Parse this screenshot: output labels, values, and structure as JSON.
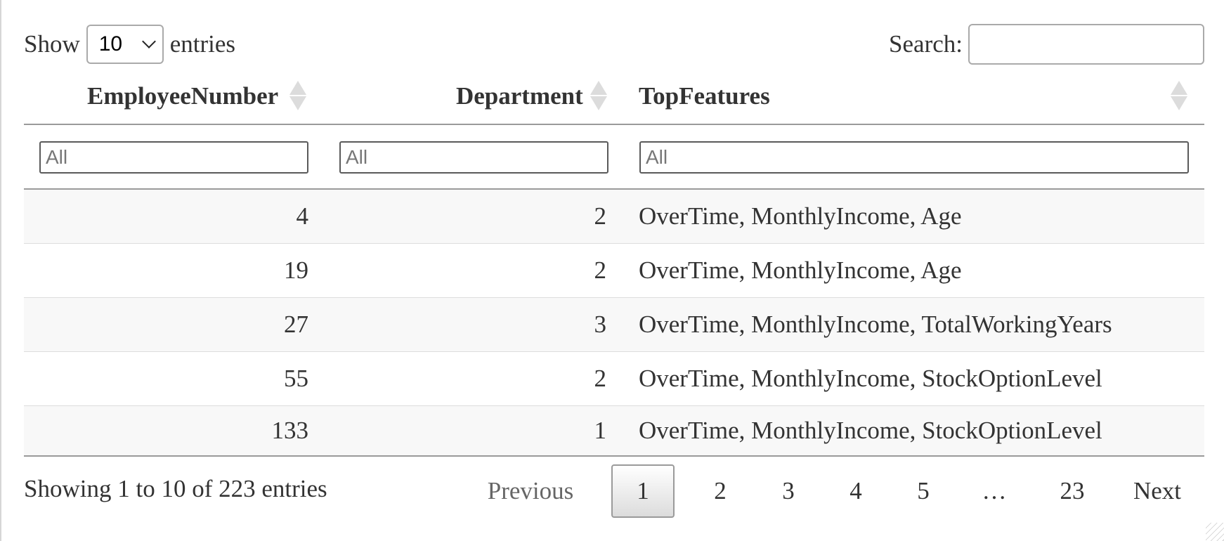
{
  "length_menu": {
    "show_label": "Show",
    "selected": "10",
    "entries_label": "entries"
  },
  "search": {
    "label": "Search:",
    "value": ""
  },
  "columns": [
    {
      "label": "EmployeeNumber"
    },
    {
      "label": "Department"
    },
    {
      "label": "TopFeatures"
    }
  ],
  "filters": [
    "All",
    "All",
    "All"
  ],
  "rows": [
    {
      "employee_number": "4",
      "department": "2",
      "top_features": "OverTime, MonthlyIncome, Age"
    },
    {
      "employee_number": "19",
      "department": "2",
      "top_features": "OverTime, MonthlyIncome, Age"
    },
    {
      "employee_number": "27",
      "department": "3",
      "top_features": "OverTime, MonthlyIncome, TotalWorkingYears"
    },
    {
      "employee_number": "55",
      "department": "2",
      "top_features": "OverTime, MonthlyIncome, StockOptionLevel"
    },
    {
      "employee_number": "133",
      "department": "1",
      "top_features": "OverTime, MonthlyIncome, StockOptionLevel"
    }
  ],
  "info": "Showing 1 to 10 of 223 entries",
  "pagination": {
    "previous": "Previous",
    "pages": [
      "1",
      "2",
      "3",
      "4",
      "5",
      "…",
      "23"
    ],
    "current": "1",
    "next": "Next"
  },
  "icons": {
    "sort": "sort-both-icon",
    "dropdown": "chevron-down-icon",
    "resize": "resize-handle-icon"
  }
}
